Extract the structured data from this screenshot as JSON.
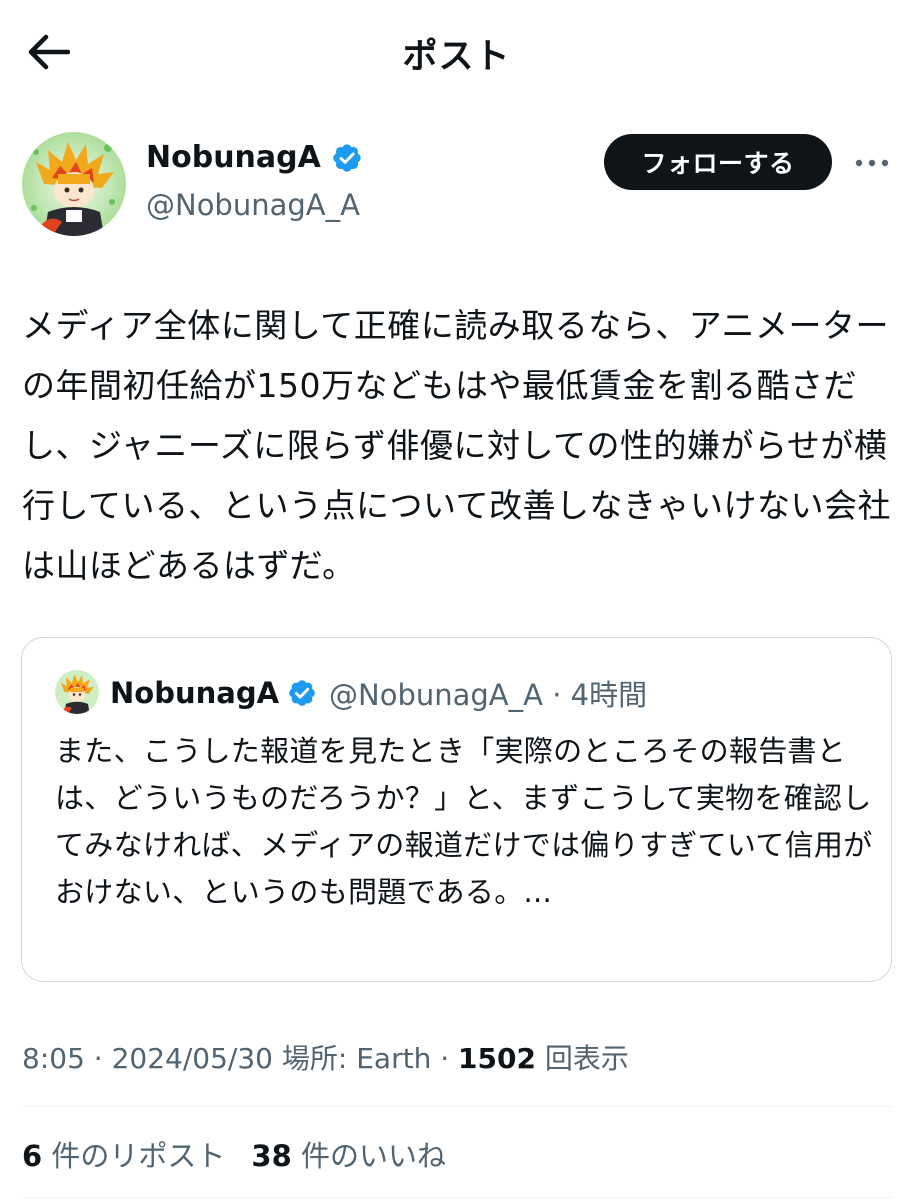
{
  "header": {
    "title": "ポスト",
    "back_icon": "arrow-left-icon"
  },
  "author": {
    "name": "NobunagA",
    "handle": "@NobunagA_A",
    "verified": true,
    "follow_label": "フォローする"
  },
  "post": {
    "text": "メディア全体に関して正確に読み取るなら、アニメーターの年間初任給が150万などもはや最低賃金を割る酷さだし、ジャニーズに限らず俳優に対しての性的嫌がらせが横行している、という点について改善しなきゃいけない会社は山ほどあるはずだ。",
    "time": "8:05",
    "date": "2024/05/30",
    "location_label": "場所: Earth",
    "views_count": "1502",
    "views_label": "回表示"
  },
  "quoted": {
    "name": "NobunagA",
    "handle": "@NobunagA_A",
    "time_ago": "4時間",
    "text": "また、こうした報道を見たとき「実際のところその報告書とは、どういうものだろうか？」と、まずこうして実物を確認してみなければ、メディアの報道だけでは偏りすぎていて信用がおけない、というのも問題である。..."
  },
  "stats": {
    "reposts_count": "6",
    "reposts_label": "件のリポスト",
    "likes_count": "38",
    "likes_label": "件のいいね"
  },
  "colors": {
    "text": "#0f1419",
    "secondary": "#536471",
    "verified": "#1d9bf0",
    "follow_bg": "#0f1419",
    "border": "#cfd9de"
  }
}
